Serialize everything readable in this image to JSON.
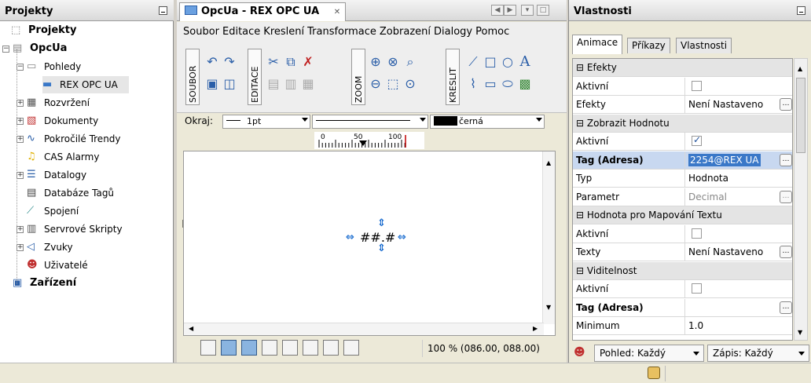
{
  "projects_panel": {
    "title": "Projekty",
    "tree": [
      {
        "label": "Projekty",
        "bold": true,
        "icon": "projects-icon"
      },
      {
        "label": "OpcUa",
        "bold": true,
        "icon": "folder-icon"
      },
      {
        "label": "Pohledy",
        "bold": false,
        "icon": "views-icon"
      },
      {
        "label": "REX OPC UA",
        "bold": false,
        "icon": "screen-icon"
      },
      {
        "label": "Rozvržení",
        "bold": false,
        "icon": "layout-icon"
      },
      {
        "label": "Dokumenty",
        "bold": false,
        "icon": "pdf-icon"
      },
      {
        "label": "Pokročilé Trendy",
        "bold": false,
        "icon": "trend-icon"
      },
      {
        "label": "CAS Alarmy",
        "bold": false,
        "icon": "bell-icon"
      },
      {
        "label": "Datalogy",
        "bold": false,
        "icon": "datalog-icon"
      },
      {
        "label": "Databáze Tagů",
        "bold": false,
        "icon": "database-icon"
      },
      {
        "label": "Spojení",
        "bold": false,
        "icon": "connection-icon"
      },
      {
        "label": "Servrové Skripty",
        "bold": false,
        "icon": "script-icon"
      },
      {
        "label": "Zvuky",
        "bold": false,
        "icon": "speaker-icon"
      },
      {
        "label": "Uživatelé",
        "bold": false,
        "icon": "users-icon"
      },
      {
        "label": "Zařízení",
        "bold": true,
        "icon": "device-icon"
      }
    ]
  },
  "editor": {
    "tab_title": "OpcUa - REX OPC UA",
    "menu": [
      "Soubor",
      "Editace",
      "Kreslení",
      "Transformace",
      "Zobrazení",
      "Dialogy",
      "Pomoc"
    ],
    "toolbar_groups": [
      "SOUBOR",
      "EDITACE",
      "ZOOM",
      "KRESLIT"
    ],
    "okraj_label": "Okraj:",
    "line_width": "1pt",
    "color_name": "černá",
    "ruler_labels": [
      "0",
      "50",
      "100"
    ],
    "placeholder_text": "##.#",
    "zoom_status": "100 % (086.00, 088.00)"
  },
  "properties_panel": {
    "title": "Vlastnosti",
    "tabs": [
      "Animace",
      "Příkazy",
      "Vlastnosti"
    ],
    "rows": [
      {
        "type": "cat",
        "label": "Efekty"
      },
      {
        "type": "check",
        "label": "Aktivní",
        "checked": false
      },
      {
        "type": "text",
        "label": "Efekty",
        "value": "Není Nastaveno",
        "ellipsis": true
      },
      {
        "type": "cat",
        "label": "Zobrazit Hodnotu"
      },
      {
        "type": "check",
        "label": "Aktivní",
        "checked": true
      },
      {
        "type": "text",
        "label": "Tag (Adresa)",
        "value": "2254@REX UA",
        "ellipsis": true,
        "highlight": true
      },
      {
        "type": "text",
        "label": "Typ",
        "value": "Hodnota"
      },
      {
        "type": "text",
        "label": "Parametr",
        "value": "Decimal",
        "ellipsis": true,
        "dim": true
      },
      {
        "type": "cat",
        "label": "Hodnota pro Mapování Textu"
      },
      {
        "type": "check",
        "label": "Aktivní",
        "checked": false
      },
      {
        "type": "text",
        "label": "Texty",
        "value": "Není Nastaveno",
        "ellipsis": true
      },
      {
        "type": "cat",
        "label": "Viditelnost"
      },
      {
        "type": "check",
        "label": "Aktivní",
        "checked": false
      },
      {
        "type": "text",
        "label": "Tag (Adresa)",
        "value": "",
        "ellipsis": true,
        "bold": true
      },
      {
        "type": "text",
        "label": "Minimum",
        "value": "1.0"
      }
    ],
    "view_filter": "Pohled: Každý",
    "write_filter": "Zápis: Každý"
  }
}
